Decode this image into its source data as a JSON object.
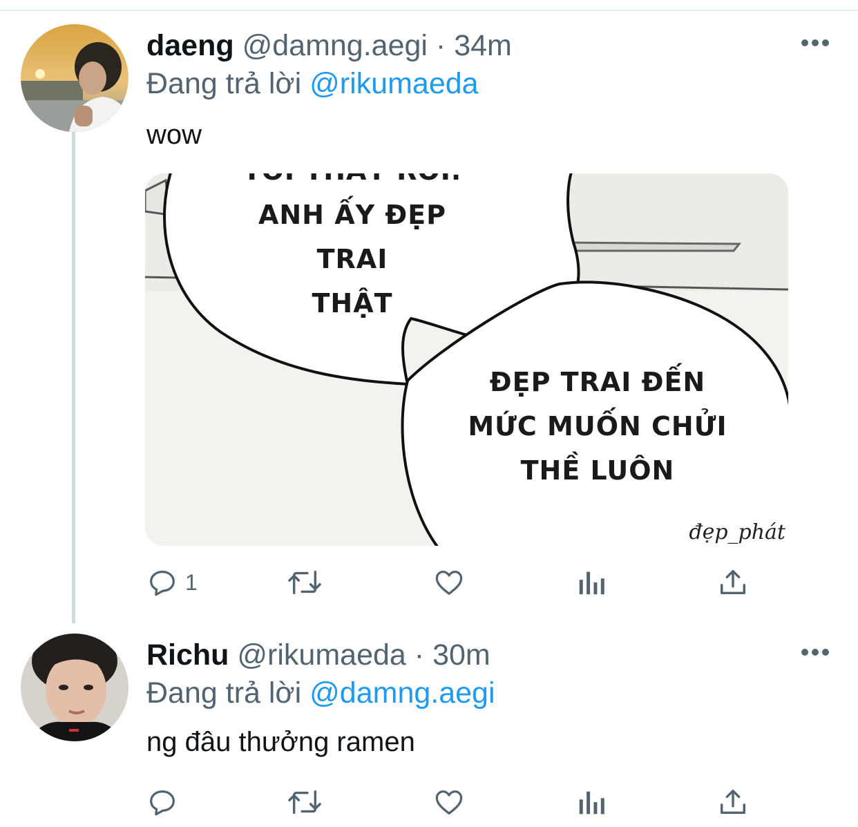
{
  "tweets": [
    {
      "name": "daeng",
      "handle": "@damng.aegi",
      "separator": "·",
      "time": "34m",
      "reply_prefix": "Đang trả lời",
      "reply_to": "@rikumaeda",
      "text": "wow",
      "reply_count": "1",
      "media": {
        "bubble_top_partial": "TÔI THẤY RỒI.",
        "bubble_top_line1": "ANH ẤY ĐẸP TRAI",
        "bubble_top_line2": "THẬT",
        "bubble_bottom_line1": "ĐẸP TRAI ĐẾN",
        "bubble_bottom_line2": "MỨC MUỐN CHỬI",
        "bubble_bottom_line3": "THỀ LUÔN",
        "credit": "đẹp_phát"
      }
    },
    {
      "name": "Richu",
      "handle": "@rikumaeda",
      "separator": "·",
      "time": "30m",
      "reply_prefix": "Đang trả lời",
      "reply_to": "@damng.aegi",
      "text": "ng đâu thưởng ramen"
    }
  ],
  "icons": [
    "more-icon",
    "reply-icon",
    "retweet-icon",
    "like-icon",
    "analytics-icon",
    "share-icon"
  ],
  "colors": {
    "accent": "#1d9bf0",
    "secondary_text": "#536471",
    "thread_line": "#cfd9de"
  }
}
